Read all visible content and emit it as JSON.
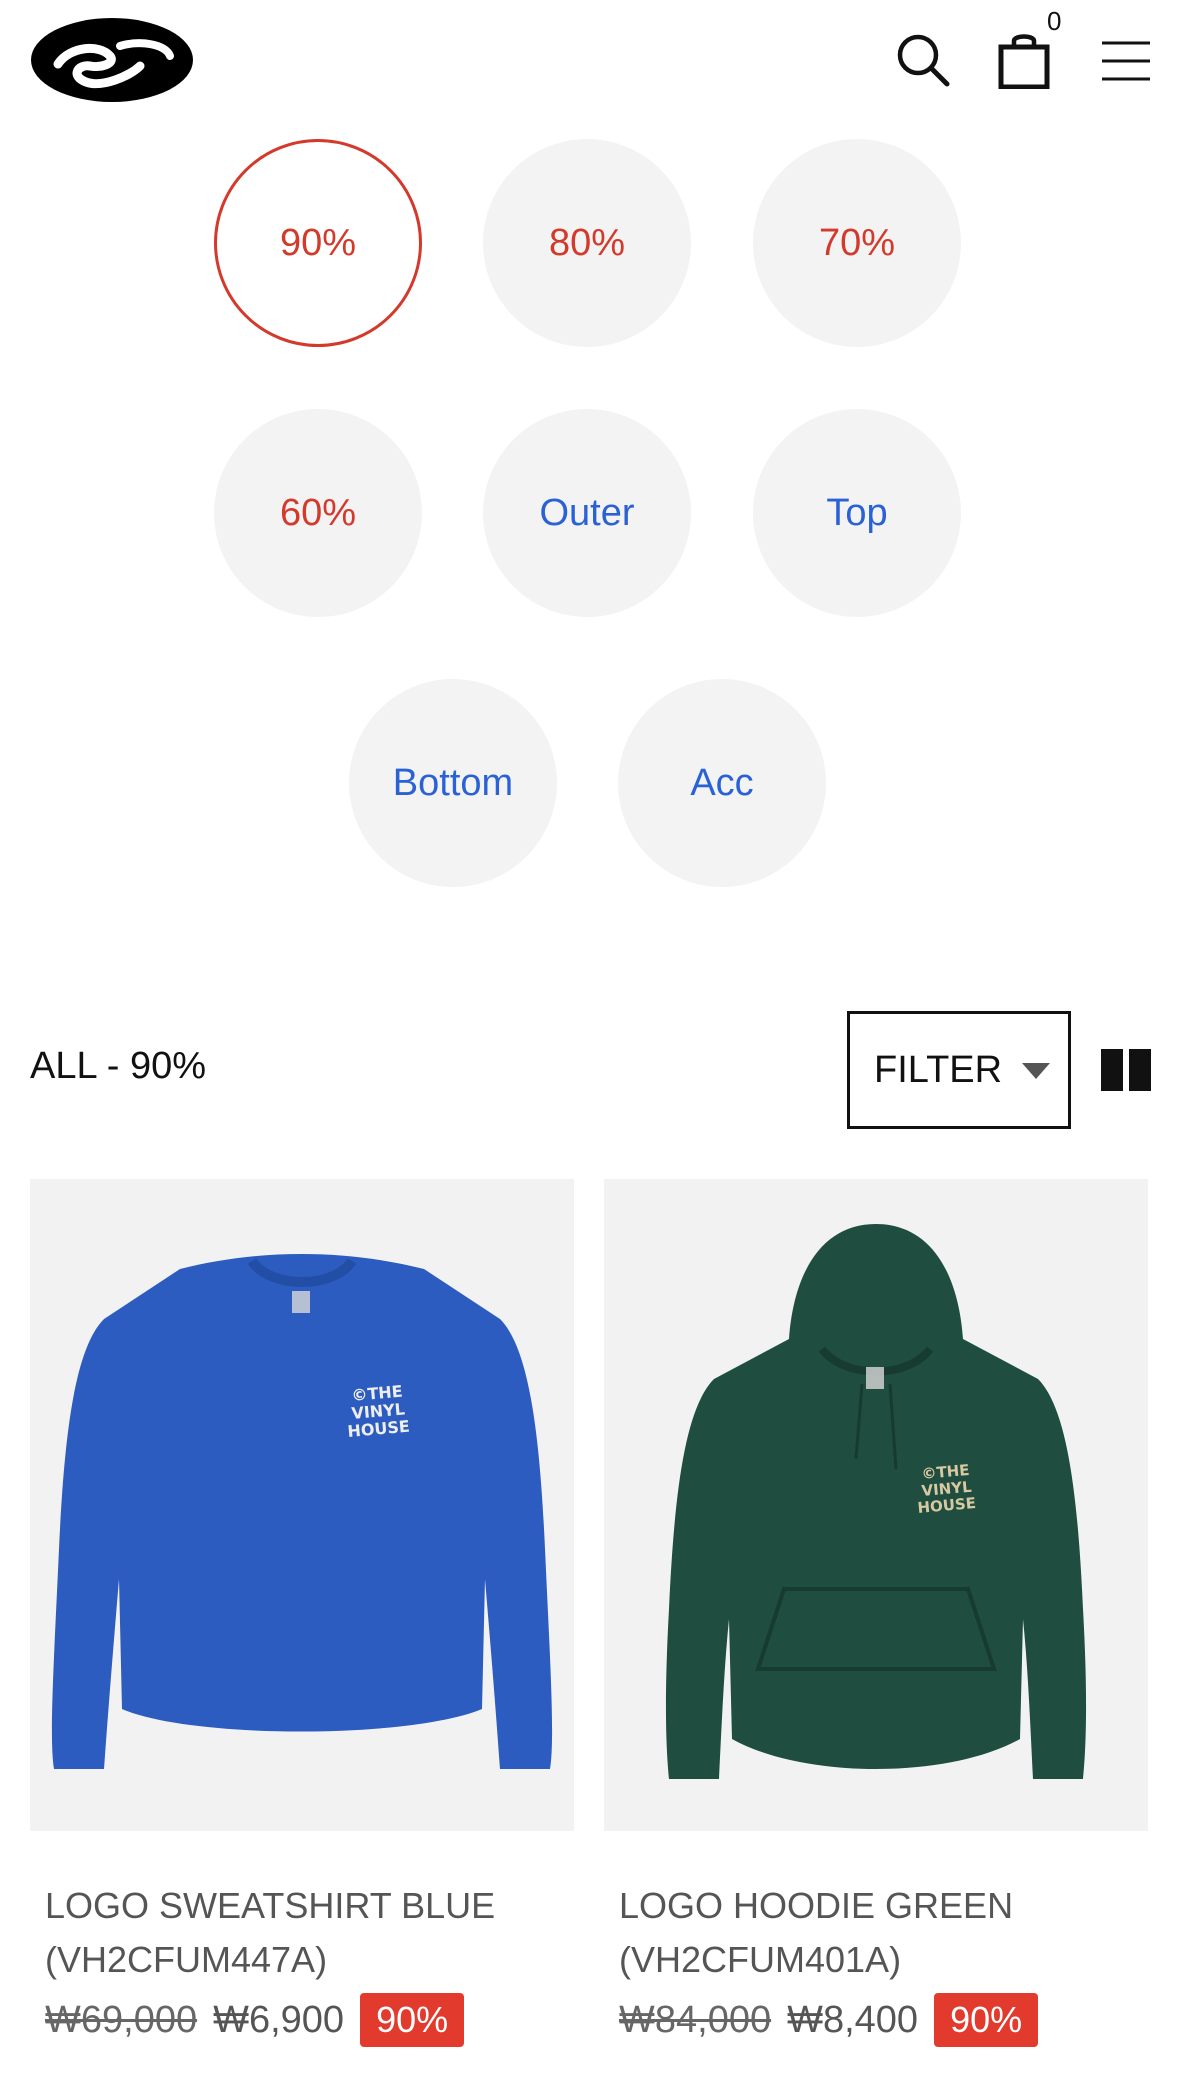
{
  "header": {
    "cart_count": "0"
  },
  "categories": [
    {
      "label": "90%",
      "kind": "discount",
      "active": true
    },
    {
      "label": "80%",
      "kind": "discount",
      "active": false
    },
    {
      "label": "70%",
      "kind": "discount",
      "active": false
    },
    {
      "label": "60%",
      "kind": "discount",
      "active": false
    },
    {
      "label": "Outer",
      "kind": "category",
      "active": false
    },
    {
      "label": "Top",
      "kind": "category",
      "active": false
    },
    {
      "label": "Bottom",
      "kind": "category",
      "active": false
    },
    {
      "label": "Acc",
      "kind": "category",
      "active": false
    }
  ],
  "listing": {
    "title": "ALL - 90%",
    "filter_label": "FILTER"
  },
  "products": [
    {
      "name": "LOGO SWEATSHIRT BLUE (VH2CFUM447A)",
      "original_price": "₩69,000",
      "sale_price": "₩6,900",
      "discount_badge": "90%",
      "image_color": "#2c5cc0",
      "print_text": "©THE VINYL HOUSE"
    },
    {
      "name": "LOGO HOODIE GREEN (VH2CFUM401A)",
      "original_price": "₩84,000",
      "sale_price": "₩8,400",
      "discount_badge": "90%",
      "image_color": "#1f4d3f",
      "print_text": "©THE VINYL HOUSE"
    }
  ],
  "colors": {
    "discount_red": "#d33a2c",
    "category_blue": "#2a62d6",
    "badge_red": "#e23a2d"
  }
}
